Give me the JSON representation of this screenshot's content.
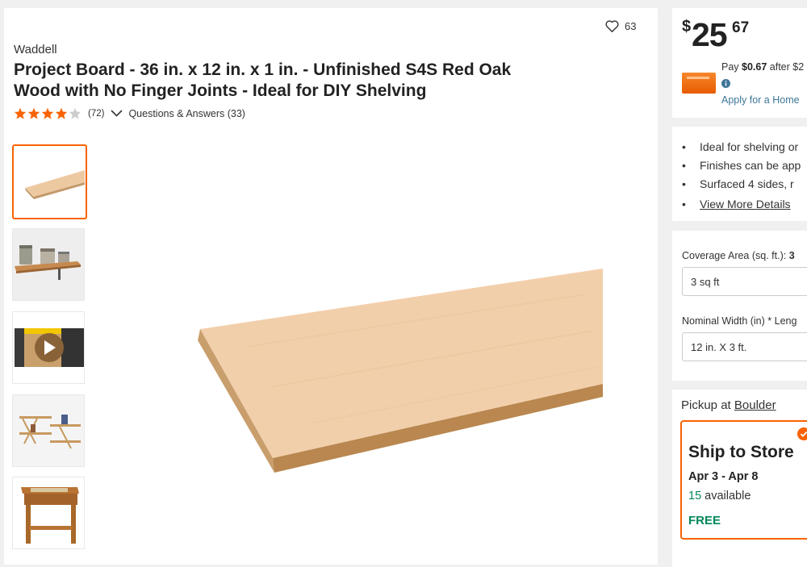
{
  "product": {
    "brand": "Waddell",
    "title": "Project Board - 36 in. x 12 in. x 1 in. - Unfinished S4S Red Oak Wood with No Finger Joints - Ideal for DIY Shelving",
    "favorites_count": "63",
    "rating": 4,
    "rating_max": 5,
    "reviews_count": "(72)",
    "qa_label": "Questions & Answers (33)",
    "thumbnails": [
      {
        "name": "board-plain",
        "selected": true
      },
      {
        "name": "shelf-with-jars",
        "selected": false
      },
      {
        "name": "video",
        "selected": false
      },
      {
        "name": "wall-shelves",
        "selected": false
      },
      {
        "name": "side-table",
        "selected": false
      }
    ]
  },
  "pricing": {
    "dollar_sign": "$",
    "dollars": "25",
    "cents": "67",
    "pay_prefix": "Pay ",
    "pay_amount": "$0.67",
    "pay_suffix": " after $2",
    "apply_link": "Apply for a Home"
  },
  "highlights": {
    "items": [
      "Ideal for shelving or",
      "Finishes can be app",
      "Surfaced 4 sides, r"
    ],
    "more_link": "View More Details"
  },
  "options": {
    "coverage_label": "Coverage Area (sq. ft.): ",
    "coverage_value_bold": "3",
    "coverage_selected": "3 sq ft",
    "size_label": "Nominal Width (in) * Leng",
    "size_selected": "12 in. X 3 ft."
  },
  "fulfillment": {
    "pickup_prefix": "Pickup at ",
    "store_name": "Boulder",
    "ship_title": "Ship to Store",
    "ship_dates": "Apr 3 - Apr 8",
    "available_count": "15",
    "available_suffix": " available",
    "shipping_cost": "FREE"
  },
  "colors": {
    "accent": "#f96302",
    "green": "#00875a",
    "link": "#3e7697",
    "star": "#f96302",
    "star_empty": "#cccccc"
  }
}
